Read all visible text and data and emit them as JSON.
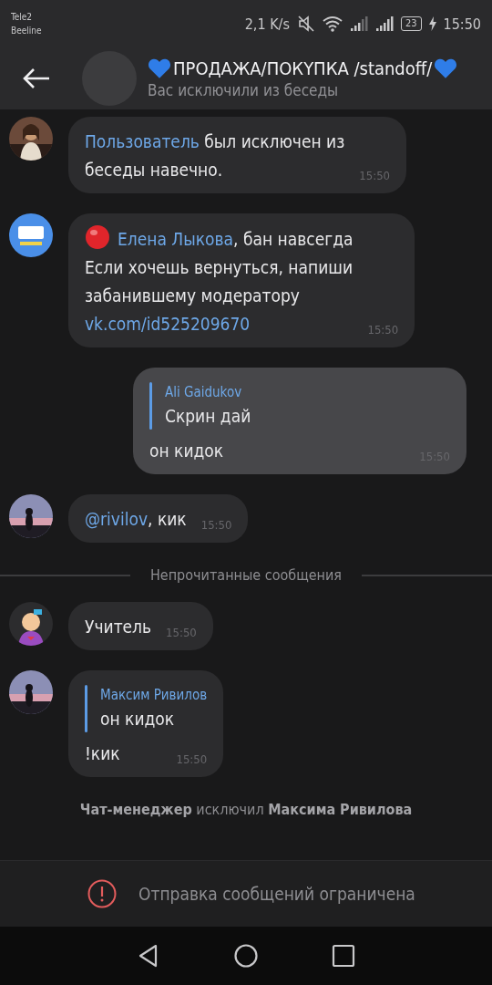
{
  "status_bar": {
    "carriers": [
      "Tele2",
      "Beeline"
    ],
    "speed": "2,1 K/s",
    "battery": "23",
    "time": "15:50"
  },
  "header": {
    "title": "ПРОДАЖА/ПОКҮПКА /standoff/",
    "subtitle": "Вас исключили из беседы"
  },
  "messages": [
    {
      "kind": "incoming",
      "avatar": {
        "kind": "picture"
      },
      "flagged": false,
      "parts": [
        {
          "text": "Пользователь",
          "link": true
        },
        {
          "text": " был исключен из\nбеседы навечно.",
          "link": false
        }
      ],
      "time": "15:50"
    },
    {
      "kind": "incoming",
      "avatar": {
        "kind": "picture"
      },
      "flagged": true,
      "parts": [
        {
          "text": "Елена Лыкова",
          "link": true
        },
        {
          "text": ", бан навсегда\nЕсли хочешь вернуться, напиши\nзабанившему модератору\n",
          "link": false
        },
        {
          "text": "vk.com/id525209670",
          "link": true
        }
      ],
      "time": "15:50"
    },
    {
      "kind": "outgoing",
      "flagged": false,
      "reply": {
        "author": "Ali Gaidukov",
        "text": "Скрин дай"
      },
      "parts": [
        {
          "text": "он кидок",
          "link": false
        }
      ],
      "time": "15:50"
    },
    {
      "kind": "incoming",
      "avatar": {
        "kind": "picture"
      },
      "flagged": false,
      "parts": [
        {
          "text": "@rivilov",
          "link": true
        },
        {
          "text": ", кик",
          "link": false
        }
      ],
      "time": "15:50"
    },
    {
      "kind": "divider",
      "text": "Непрочитанные сообщения"
    },
    {
      "kind": "incoming",
      "avatar": {
        "kind": "picture"
      },
      "flagged": false,
      "parts": [
        {
          "text": "Учитель",
          "link": false
        }
      ],
      "time": "15:50"
    },
    {
      "kind": "incoming",
      "avatar": {
        "kind": "picture"
      },
      "flagged": false,
      "reply": {
        "author": "Максим Ривилов",
        "text": "он кидок"
      },
      "parts": [
        {
          "text": "!кик",
          "link": false
        }
      ],
      "time": "15:50"
    },
    {
      "kind": "system",
      "text": "**Чат-менеджер** исключил **Максима Ривилова**"
    }
  ],
  "restriction": {
    "text": "Отправка сообщений ограничена"
  }
}
